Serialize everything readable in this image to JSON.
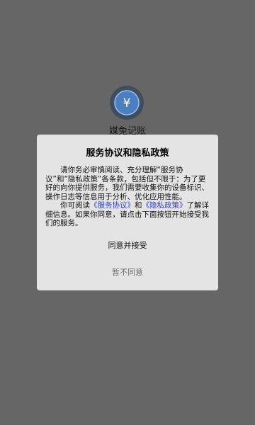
{
  "app": {
    "logo_icon": "yen-coin-icon",
    "logo_glyph": "¥",
    "name": "媒兔记账"
  },
  "dialog": {
    "title": "服务协议和隐私政策",
    "paragraph1": "请你务必审慎阅读、充分理解“服务协议”和“隐私政策”各条款，包括但不限于：为了更好的向你提供服务，我们需要收集你的设备标识、操作日志等信息用于分析、优化应用性能。",
    "paragraph2_prefix": "你可阅读",
    "service_link": "《服务协议》",
    "paragraph2_and": "和",
    "privacy_link": "《隐私政策》",
    "paragraph2_suffix": "了解详细信息。如果你同意，请点击下面按钮开始接受我们的服务。",
    "accept_label": "同意并接受",
    "decline_label": "暂不同意"
  },
  "colors": {
    "overlay": "#666666",
    "dialog_bg": "#e4e4e4",
    "link": "#2a3fd6",
    "logo_bg": "#3f4e5c",
    "logo_ring": "#4a7fc1"
  }
}
